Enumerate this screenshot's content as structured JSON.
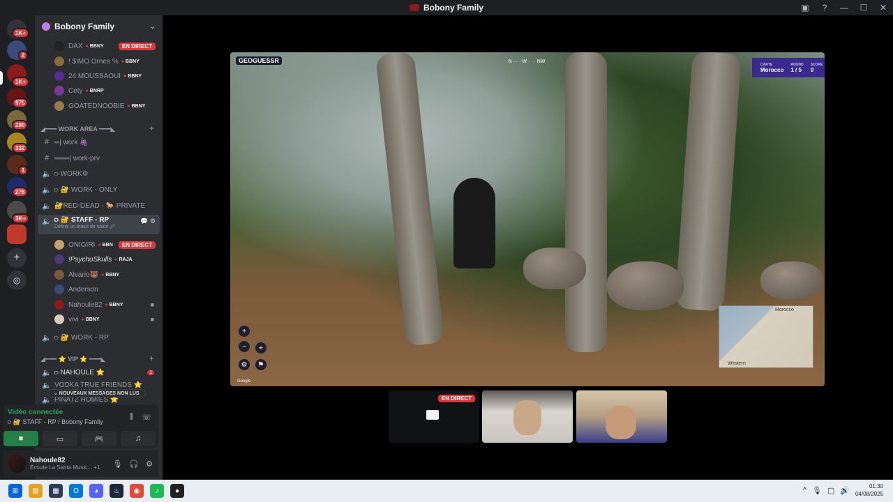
{
  "window": {
    "title": "Bobony Family"
  },
  "servers": [
    {
      "badge": "1K+"
    },
    {
      "badge": "2"
    },
    {
      "badge": "1K+"
    },
    {
      "badge": "975"
    },
    {
      "badge": "290"
    },
    {
      "badge": "332"
    },
    {
      "badge": "1"
    },
    {
      "badge": "276"
    },
    {
      "badge": "3K+"
    }
  ],
  "guild": {
    "name": "Bobony Family"
  },
  "members_top": [
    {
      "name": "DAX",
      "tag": "BBNY",
      "live": "EN DIRECT"
    },
    {
      "name": "! $IMO Ornes %",
      "tag": "BBNY"
    },
    {
      "name": "24 MOUSSAOUI",
      "tag": "BBNY"
    },
    {
      "name": "Cety",
      "tag": "BNRP"
    },
    {
      "name": "GOATEDNOOBIE",
      "tag": "BBNY"
    }
  ],
  "category_work": "◢━━━ WORK AREA ━━━◣",
  "channels": [
    {
      "name": "═| work 🍇"
    },
    {
      "name": "═══| work-prv"
    },
    {
      "name": "⫐ WORK⚙"
    },
    {
      "name": "⫐ 🔐 WORK - ONLY"
    },
    {
      "name": "🔐RED-DEAD - 🐎 PRIVATE"
    }
  ],
  "active_channel": {
    "name": "⫐ 🔐 STAFF - RP",
    "status": "Définir un statut de salon 🖉"
  },
  "members_staff": [
    {
      "name": "ONIGIRI",
      "tag": "BBN",
      "live": "EN DIRECT"
    },
    {
      "name": "!PsychoSkulls",
      "tag": "RAJA"
    },
    {
      "name": "Alvario🐻",
      "tag": "BBNY"
    },
    {
      "name": "Anderson",
      "tag": ""
    },
    {
      "name": "Nahoule82",
      "tag": "BBNY"
    },
    {
      "name": "vivi",
      "tag": "BBNY"
    }
  ],
  "channel_work_rp": "⫐ 🔐 WORK - RP",
  "category_vip": "◢━━━ ⭐ VIP ⭐ ━━━◣",
  "vip_channels": [
    {
      "name": "⫐ NAHOULE ⭐",
      "badge": "1"
    },
    {
      "name": "VODKA TRUE FRIENDS ⭐"
    },
    {
      "name": "PINATZ HOMIES ⭐"
    }
  ],
  "new_messages": "⌄ NOUVEAUX MESSAGES NON LUS",
  "voice": {
    "status": "Vidéo connectée",
    "location": "⫐ 🔐 STAFF - RP / Bobony Family"
  },
  "user": {
    "name": "Nahoule82",
    "activity": "Écoute La Santa Music... +1"
  },
  "stream": {
    "logo": "GEOGUESSR",
    "score": {
      "map_label": "CARTE",
      "map": "Morocco",
      "round_label": "ROUND",
      "round": "1 / 5",
      "score_label": "SCORE",
      "score": "0"
    },
    "compass": "N  ·  ·  ·  W  ·  ·  ·  NW",
    "minimap": {
      "country": "Morocco",
      "region": "Western",
      "google": "Google"
    }
  },
  "tiles": [
    {
      "live": "EN DIRECT"
    },
    {},
    {}
  ],
  "taskbar": {
    "time": "01:30",
    "date": "04/08/2025"
  }
}
